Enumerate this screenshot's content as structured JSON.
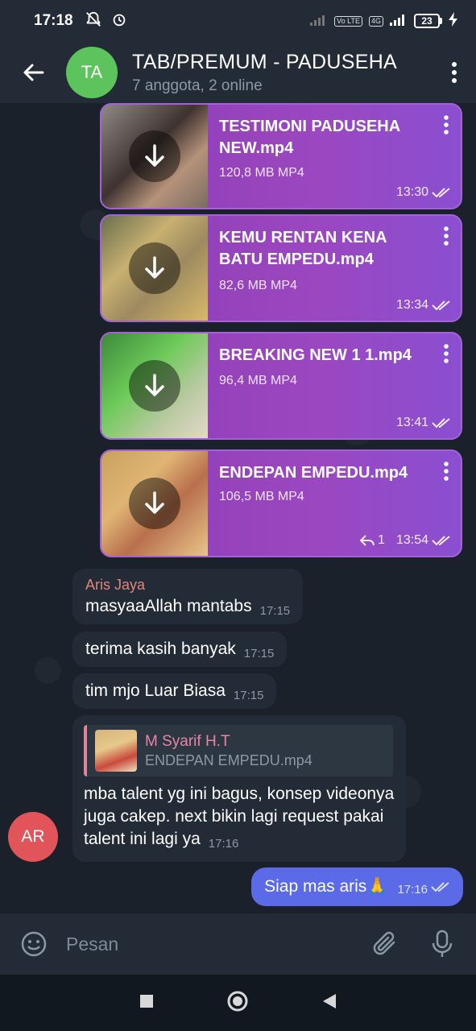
{
  "status": {
    "time": "17:18",
    "battery": "23",
    "network": "4G",
    "volte": "Vo LTE"
  },
  "header": {
    "avatar": "TA",
    "title": "TAB/PREMUM - PADUSEHA",
    "subtitle": "7 anggota, 2 online"
  },
  "files": [
    {
      "name": "TESTIMONI PADUSEHA NEW.mp4",
      "size": "120,8 MB MP4",
      "time": "13:30"
    },
    {
      "name": "KEMU RENTAN KENA BATU EMPEDU.mp4",
      "size": "82,6 MB MP4",
      "time": "13:34"
    },
    {
      "name": "BREAKING NEW 1 1.mp4",
      "size": "96,4 MB MP4",
      "time": "13:41"
    },
    {
      "name": "ENDEPAN EMPEDU.mp4",
      "size": "106,5 MB MP4",
      "time": "13:54",
      "replies": "1"
    }
  ],
  "messages": [
    {
      "sender": "Aris Jaya",
      "text": "masyaaAllah mantabs",
      "time": "17:15"
    },
    {
      "text": "terima kasih banyak",
      "time": "17:15"
    },
    {
      "text": "tim mjo Luar Biasa",
      "time": "17:15"
    },
    {
      "reply_name": "M Syarif H.T",
      "reply_file": "ENDEPAN EMPEDU.mp4",
      "text": "mba talent yg ini bagus, konsep videonya juga cakep. next bikin lagi request pakai talent ini lagi ya",
      "time": "17:16"
    }
  ],
  "sender_avatar": "AR",
  "outgoing": {
    "text": "Siap mas aris🙏",
    "time": "17:16"
  },
  "input": {
    "placeholder": "Pesan"
  },
  "colors": {
    "header_bg": "#222b36",
    "file_bubble": "#9b47c0",
    "outgoing_bubble": "#5b6ae7",
    "avatar_ta": "#5dc45d",
    "avatar_ar": "#e1555a",
    "sender_name": "#e1847a"
  }
}
